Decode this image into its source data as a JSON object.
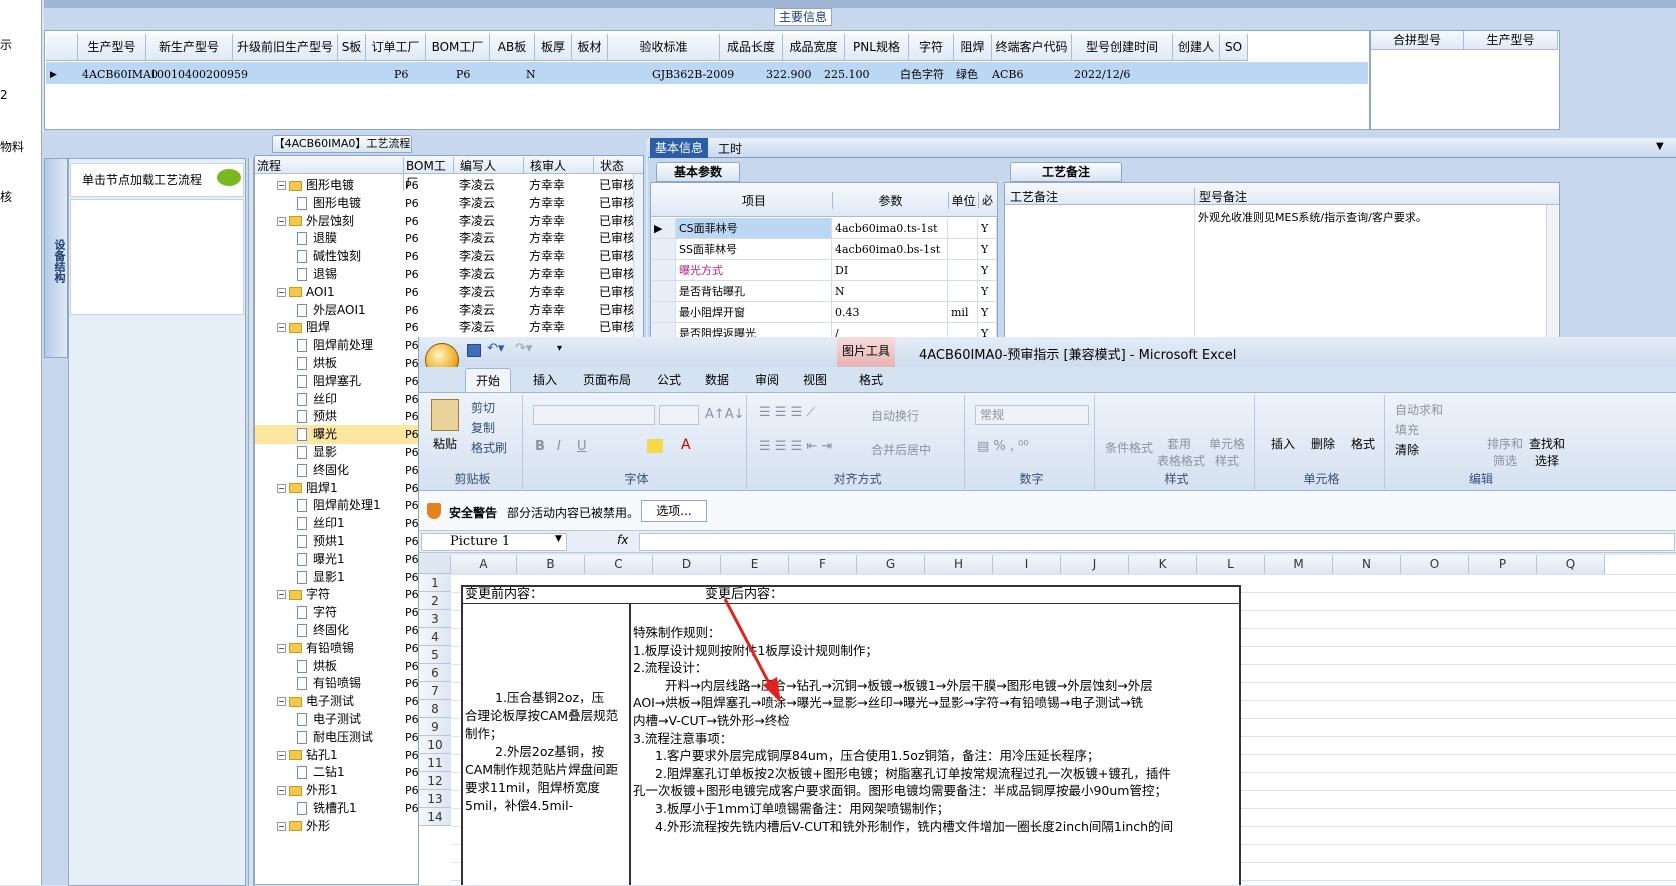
{
  "left_strip": [
    "示",
    "2",
    "物料",
    "核"
  ],
  "top": {
    "section_title": "主要信息",
    "columns": [
      "生产型号",
      "新生产型号",
      "升级前旧生产型号",
      "S板",
      "订单工厂",
      "BOM工厂",
      "AB板",
      "板厚",
      "板材",
      "验收标准",
      "成品长度",
      "成品宽度",
      "PNL规格",
      "字符",
      "阻焊",
      "终端客户代码",
      "型号创建时间",
      "创建人",
      "SO"
    ],
    "row": {
      "生产型号": "4ACB60IMA0",
      "新生产型号": "10010400200959",
      "订单工厂": "P6",
      "BOM工厂": "P6",
      "AB板": "N",
      "验收标准": "GJB362B-2009",
      "成品长度": "322.900",
      "成品宽度": "225.100",
      "字符": "白色字符",
      "阻焊": "绿色",
      "终端客户代码": "ACB6",
      "型号创建时间": "2022/12/6"
    },
    "right_columns": [
      "合拼型号",
      "生产型号"
    ]
  },
  "flow": {
    "title": "【4ACB60IMA0】工艺流程",
    "side_tab": "设备结构",
    "hint": "单击节点加载工艺流程",
    "columns": [
      "流程",
      "BOM工厂",
      "编写人",
      "核审人",
      "状态"
    ],
    "rows": [
      {
        "level": 0,
        "name": "图形电镀",
        "bom": "P6",
        "writer": "李凌云",
        "checker": "方幸幸",
        "status": "已审核"
      },
      {
        "level": 1,
        "name": "图形电镀",
        "bom": "P6",
        "writer": "李凌云",
        "checker": "方幸幸",
        "status": "已审核"
      },
      {
        "level": 0,
        "name": "外层蚀刻",
        "bom": "P6",
        "writer": "李凌云",
        "checker": "方幸幸",
        "status": "已审核"
      },
      {
        "level": 1,
        "name": "退膜",
        "bom": "P6",
        "writer": "李凌云",
        "checker": "方幸幸",
        "status": "已审核"
      },
      {
        "level": 1,
        "name": "碱性蚀刻",
        "bom": "P6",
        "writer": "李凌云",
        "checker": "方幸幸",
        "status": "已审核"
      },
      {
        "level": 1,
        "name": "退锡",
        "bom": "P6",
        "writer": "李凌云",
        "checker": "方幸幸",
        "status": "已审核"
      },
      {
        "level": 0,
        "name": "AOI1",
        "bom": "P6",
        "writer": "李凌云",
        "checker": "方幸幸",
        "status": "已审核"
      },
      {
        "level": 1,
        "name": "外层AOI1",
        "bom": "P6",
        "writer": "李凌云",
        "checker": "方幸幸",
        "status": "已审核"
      },
      {
        "level": 0,
        "name": "阻焊",
        "bom": "P6",
        "writer": "李凌云",
        "checker": "方幸幸",
        "status": "已审核"
      },
      {
        "level": 1,
        "name": "阻焊前处理",
        "bom": "P6",
        "writer": "",
        "checker": "",
        "status": ""
      },
      {
        "level": 1,
        "name": "烘板",
        "bom": "P6",
        "writer": "",
        "checker": "",
        "status": ""
      },
      {
        "level": 1,
        "name": "阻焊塞孔",
        "bom": "P6",
        "writer": "",
        "checker": "",
        "status": ""
      },
      {
        "level": 1,
        "name": "丝印",
        "bom": "P6",
        "writer": "",
        "checker": "",
        "status": ""
      },
      {
        "level": 1,
        "name": "预烘",
        "bom": "P6",
        "writer": "",
        "checker": "",
        "status": ""
      },
      {
        "level": 1,
        "name": "曝光",
        "bom": "P6",
        "writer": "",
        "checker": "",
        "status": "",
        "selected": true
      },
      {
        "level": 1,
        "name": "显影",
        "bom": "P6",
        "writer": "",
        "checker": "",
        "status": ""
      },
      {
        "level": 1,
        "name": "终固化",
        "bom": "P6",
        "writer": "",
        "checker": "",
        "status": ""
      },
      {
        "level": 0,
        "name": "阻焊1",
        "bom": "P6",
        "writer": "",
        "checker": "",
        "status": ""
      },
      {
        "level": 1,
        "name": "阻焊前处理1",
        "bom": "P6",
        "writer": "",
        "checker": "",
        "status": ""
      },
      {
        "level": 1,
        "name": "丝印1",
        "bom": "P6",
        "writer": "",
        "checker": "",
        "status": ""
      },
      {
        "level": 1,
        "name": "预烘1",
        "bom": "P6",
        "writer": "",
        "checker": "",
        "status": ""
      },
      {
        "level": 1,
        "name": "曝光1",
        "bom": "P6",
        "writer": "",
        "checker": "",
        "status": ""
      },
      {
        "level": 1,
        "name": "显影1",
        "bom": "P6",
        "writer": "",
        "checker": "",
        "status": ""
      },
      {
        "level": 0,
        "name": "字符",
        "bom": "P6",
        "writer": "",
        "checker": "",
        "status": ""
      },
      {
        "level": 1,
        "name": "字符",
        "bom": "P6",
        "writer": "",
        "checker": "",
        "status": ""
      },
      {
        "level": 1,
        "name": "终固化",
        "bom": "P6",
        "writer": "",
        "checker": "",
        "status": ""
      },
      {
        "level": 0,
        "name": "有铅喷锡",
        "bom": "P6",
        "writer": "",
        "checker": "",
        "status": ""
      },
      {
        "level": 1,
        "name": "烘板",
        "bom": "P6",
        "writer": "",
        "checker": "",
        "status": ""
      },
      {
        "level": 1,
        "name": "有铅喷锡",
        "bom": "P6",
        "writer": "",
        "checker": "",
        "status": ""
      },
      {
        "level": 0,
        "name": "电子测试",
        "bom": "P6",
        "writer": "",
        "checker": "",
        "status": ""
      },
      {
        "level": 1,
        "name": "电子测试",
        "bom": "P6",
        "writer": "",
        "checker": "",
        "status": ""
      },
      {
        "level": 1,
        "name": "耐电压测试",
        "bom": "P6",
        "writer": "",
        "checker": "",
        "status": ""
      },
      {
        "level": 0,
        "name": "钻孔1",
        "bom": "P6",
        "writer": "",
        "checker": "",
        "status": ""
      },
      {
        "level": 1,
        "name": "二钻1",
        "bom": "P6",
        "writer": "",
        "checker": "",
        "status": ""
      },
      {
        "level": 0,
        "name": "外形1",
        "bom": "P6",
        "writer": "",
        "checker": "",
        "status": ""
      },
      {
        "level": 1,
        "name": "铣槽孔1",
        "bom": "P6",
        "writer": "",
        "checker": "",
        "status": ""
      },
      {
        "level": 0,
        "name": "外形",
        "bom": "",
        "writer": "",
        "checker": "",
        "status": ""
      }
    ]
  },
  "info": {
    "tabs": [
      "基本信息",
      "工时"
    ],
    "params_title": "基本参数",
    "param_columns": [
      "项目",
      "参数",
      "单位",
      "必"
    ],
    "params": [
      {
        "item": "CS面菲林号",
        "value": "4acb60ima0.ts-1st",
        "unit": "",
        "req": "Y"
      },
      {
        "item": "SS面菲林号",
        "value": "4acb60ima0.bs-1st",
        "unit": "",
        "req": "Y"
      },
      {
        "item": "曝光方式",
        "value": "DI",
        "unit": "",
        "req": "Y"
      },
      {
        "item": "是否背钻曝孔",
        "value": "N",
        "unit": "",
        "req": "Y"
      },
      {
        "item": "最小阻焊开窗",
        "value": "0.43",
        "unit": "mil",
        "req": "Y"
      },
      {
        "item": "是否阻焊返曝光",
        "value": "/",
        "unit": "",
        "req": "Y"
      }
    ],
    "notes_title": "工艺备注",
    "note_columns": [
      "工艺备注",
      "型号备注"
    ],
    "model_note": "外观允收准则见MES系统/指示查询/客户要求。"
  },
  "excel": {
    "title": "4ACB60IMA0-预审指示  [兼容模式] - Microsoft Excel",
    "picture_tools": "图片工具",
    "ribbon_tabs": [
      "开始",
      "插入",
      "页面布局",
      "公式",
      "数据",
      "审阅",
      "视图",
      "格式"
    ],
    "clipboard": {
      "paste": "粘贴",
      "cut": "剪切",
      "copy": "复制",
      "painter": "格式刷",
      "group": "剪贴板"
    },
    "font_group": "字体",
    "align": {
      "wrap": "自动换行",
      "merge": "合并后居中",
      "group": "对齐方式"
    },
    "number": {
      "format": "常规",
      "group": "数字"
    },
    "styles": {
      "cond": "条件格式",
      "table": "套用\n表格格式",
      "cell": "单元格\n样式",
      "group": "样式"
    },
    "cells": {
      "insert": "插入",
      "delete": "删除",
      "format": "格式",
      "group": "单元格"
    },
    "editing": {
      "autosum": "自动求和",
      "fill": "填充",
      "clear": "清除",
      "sort": "排序和\n筛选",
      "find": "查找和\n选择",
      "group": "编辑"
    },
    "security": {
      "label": "安全警告",
      "text": "部分活动内容已被禁用。",
      "button": "选项..."
    },
    "name_box": "Picture 1",
    "fx": "fx",
    "columns": [
      "A",
      "B",
      "C",
      "D",
      "E",
      "F",
      "G",
      "H",
      "I",
      "J",
      "K",
      "L",
      "M",
      "N",
      "O",
      "P",
      "Q"
    ],
    "rows": [
      "1",
      "2",
      "3",
      "4",
      "5",
      "6",
      "7",
      "8",
      "9",
      "10",
      "11",
      "12",
      "13",
      "14"
    ],
    "before_label": "变更前内容：",
    "after_label": "变更后内容：",
    "before_lines": [
      "1.压合基铜2oz，压",
      "合理论板厚按CAM叠层规范",
      "制作；",
      "2.外层2oz基铜，按",
      "CAM制作规范贴片焊盘间距",
      "要求11mil，阻焊桥宽度",
      "5mil，补偿4.5mil-"
    ],
    "after_lines": [
      "特殊制作规则：",
      "1.板厚设计规则按附件1板厚设计规则制作；",
      "2.流程设计：",
      "开料→内层线路→压合→钻孔→沉铜→板镀→板镀1→外层干膜→图形电镀→外层蚀刻→外层",
      "AOI→烘板→阻焊塞孔→喷涂→曝光→显影→丝印→曝光→显影→字符→有铅喷锡→电子测试→铣",
      "内槽→V-CUT→铣外形→终检",
      "3.流程注意事项：",
      "1.客户要求外层完成铜厚84um，压合使用1.5oz铜箔，备注：用冷压延长程序；",
      "2.阻焊塞孔订单板按2次板镀+图形电镀；树脂塞孔订单按常规流程过孔一次板镀+镀孔，插件",
      "孔一次板镀+图形电镀完成客户要求面铜。图形电镀均需要备注：半成品铜厚按最小90um管控；",
      "3.板厚小于1mm订单喷锡需备注：用网架喷锡制作；",
      "4.外形流程按先铣内槽后V-CUT和铣外形制作，铣内槽文件增加一圈长度2inch间隔1inch的间"
    ],
    "arrow_color": "#e0231c"
  }
}
